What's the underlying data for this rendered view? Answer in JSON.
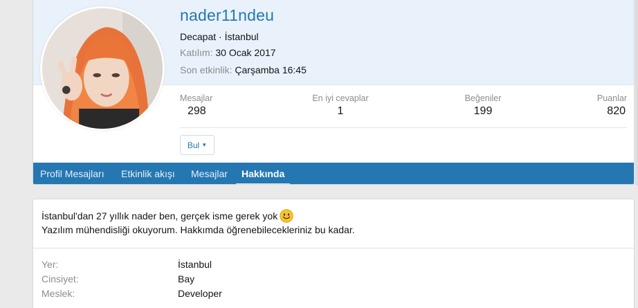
{
  "profile": {
    "username": "nader11ndeu",
    "title_line": "Decapat · İstanbul",
    "joined_label": "Katılım:",
    "joined_value": "30 Ocak 2017",
    "activity_label": "Son etkinlik:",
    "activity_value": "Çarşamba 16:45",
    "stats": [
      {
        "label": "Mesajlar",
        "value": "298"
      },
      {
        "label": "En iyi cevaplar",
        "value": "1"
      },
      {
        "label": "Beğeniler",
        "value": "199"
      },
      {
        "label": "Puanlar",
        "value": "820"
      }
    ],
    "find_button": "Bul",
    "tabs": [
      {
        "label": "Profil Mesajları"
      },
      {
        "label": "Etkinlik akışı"
      },
      {
        "label": "Mesajlar"
      },
      {
        "label": "Hakkında",
        "active": true
      }
    ]
  },
  "about": {
    "line1": "İstanbul'dan 27 yıllık nader ben, gerçek isme gerek yok",
    "line2": "Yazılım mühendisliği okuyorum. Hakkımda öğrenebileceklериniz bu kadar.",
    "fields": [
      {
        "key": "Yer:",
        "value": "İstanbul"
      },
      {
        "key": "Cinsiyet:",
        "value": "Bay"
      },
      {
        "key": "Meslek:",
        "value": "Developer"
      }
    ]
  },
  "icons": {
    "smiley": "smiley-emoji-icon",
    "caret": "caret-down-icon"
  },
  "colors": {
    "link": "#2577b1",
    "tabbar": "#2577b1",
    "banner": "#e9f2fb",
    "muted": "#8c8c8c"
  }
}
